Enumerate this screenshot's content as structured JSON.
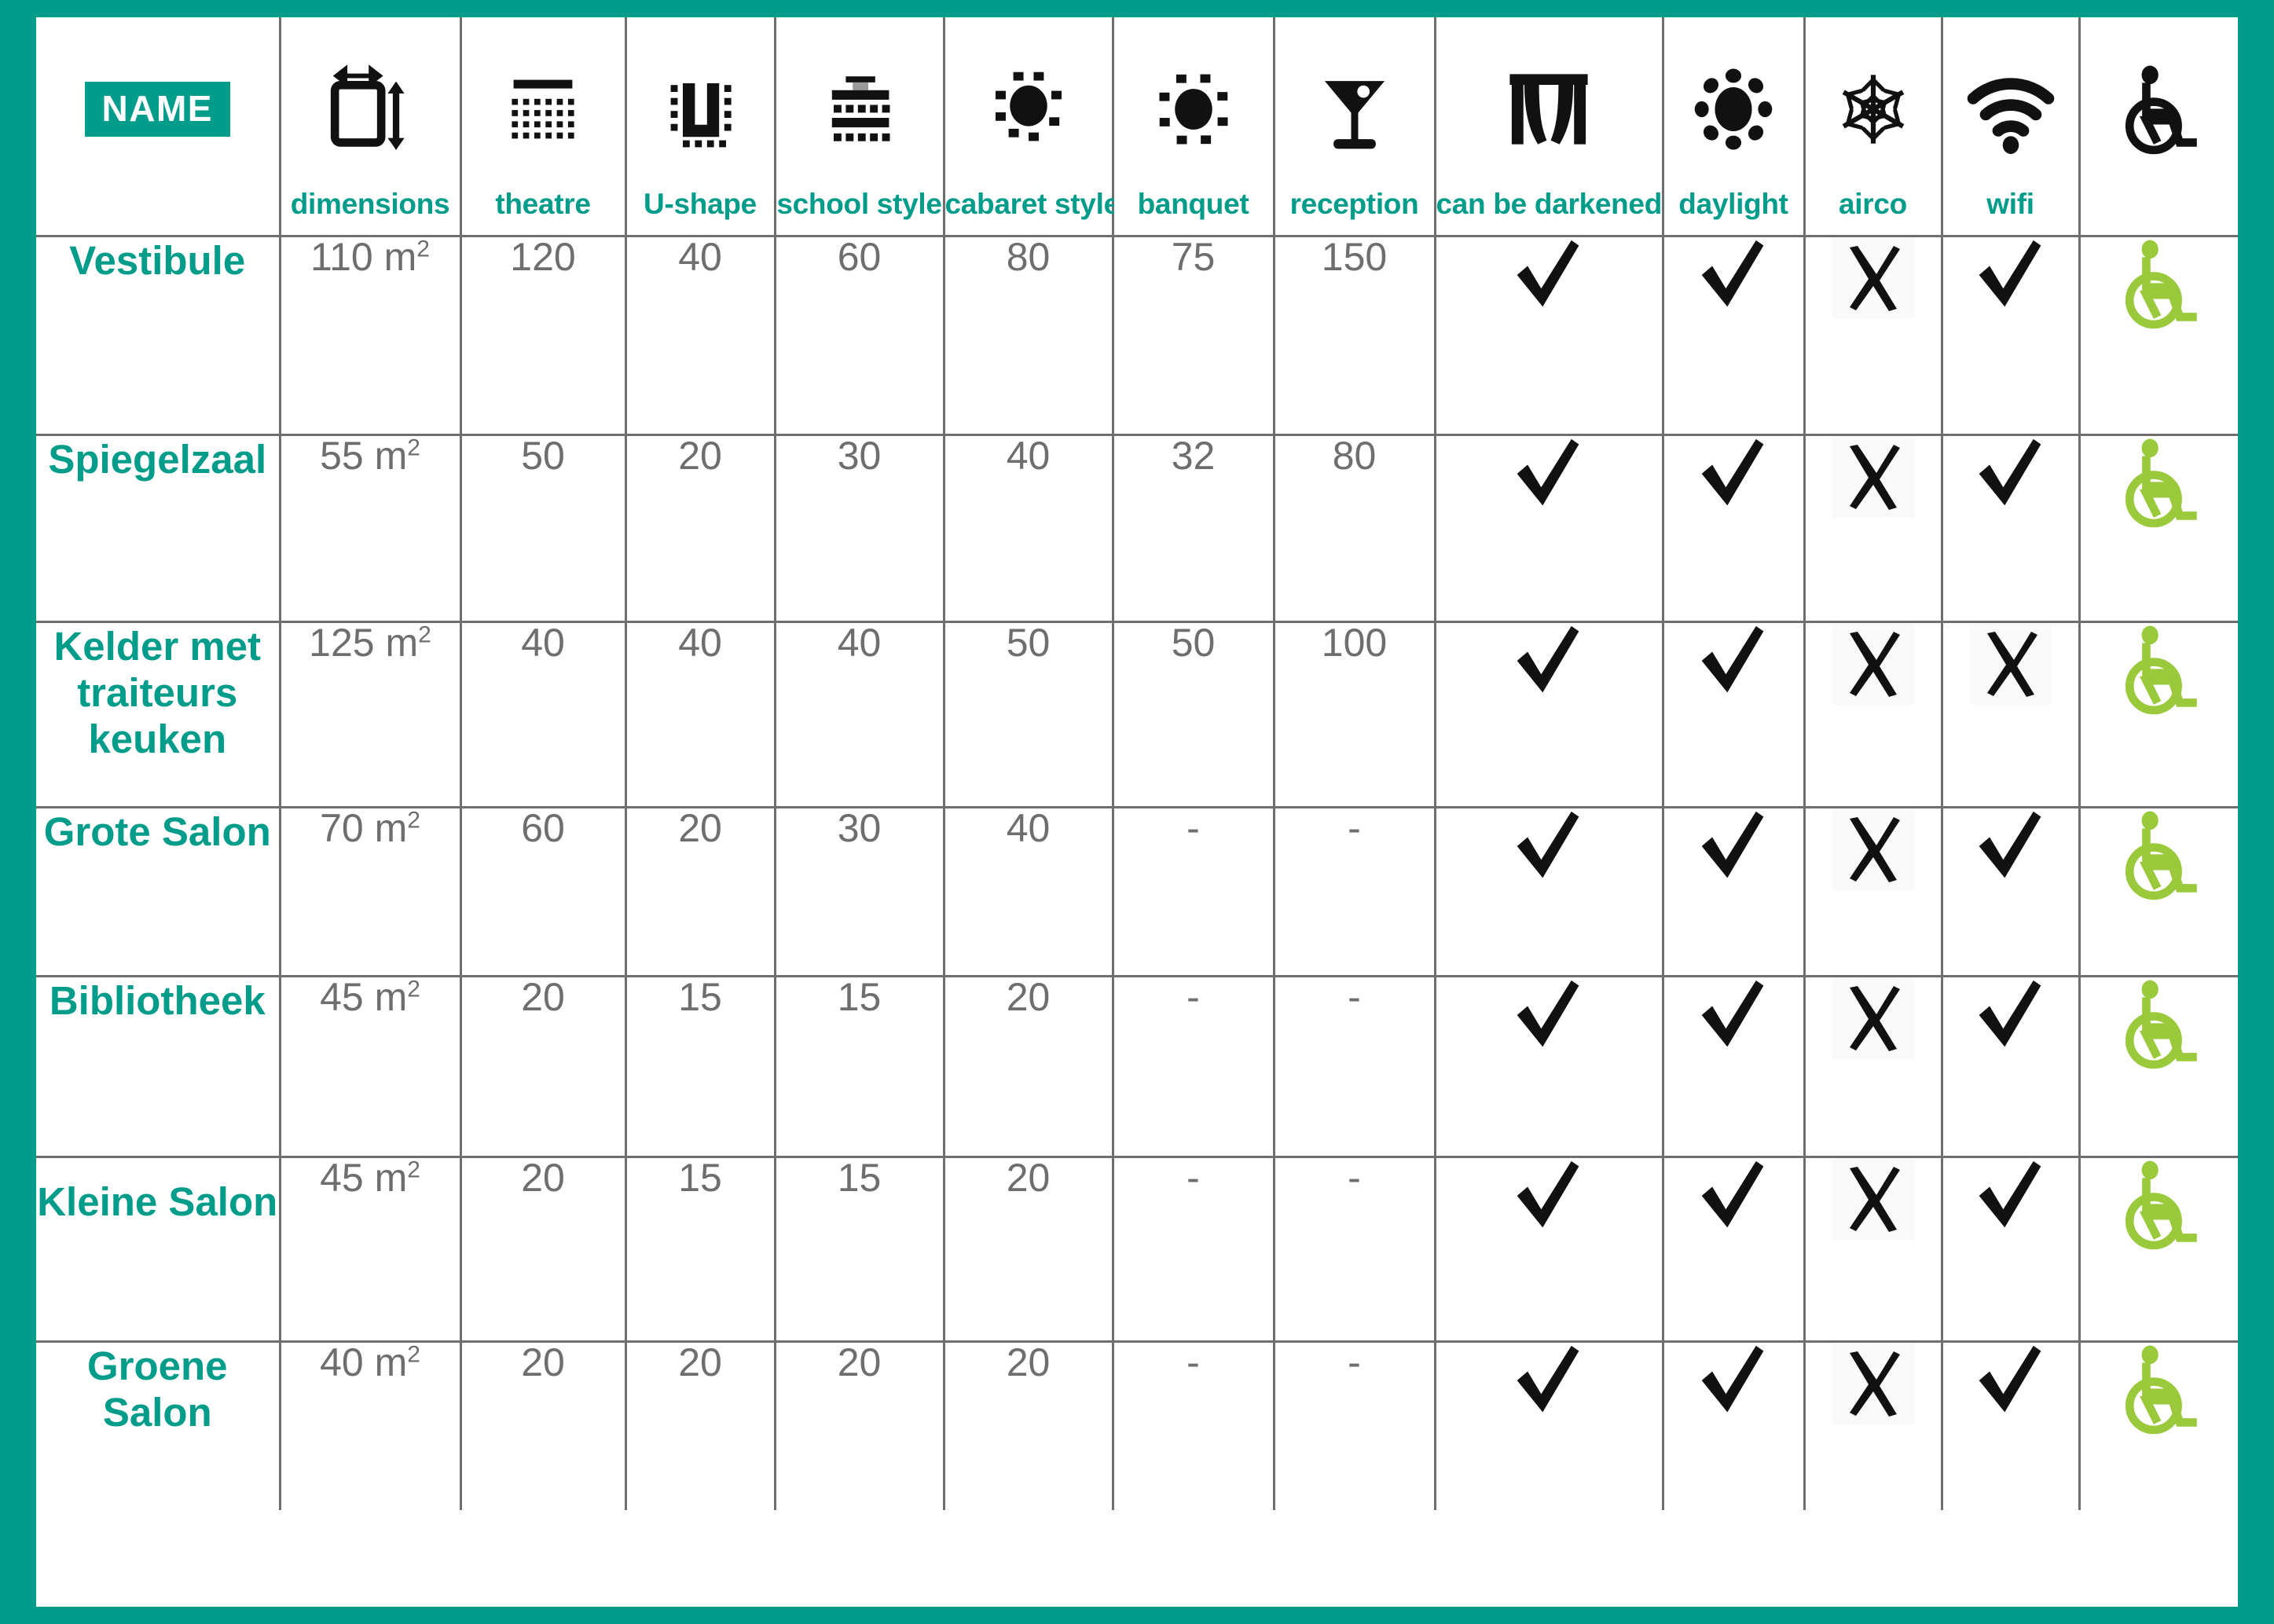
{
  "meta": {
    "accent_teal": "#019C8A",
    "grid_line": "#6e6e6e",
    "value_grey": "#6e6e6e",
    "wheelchair_green": "#9ACA3C",
    "mark_black": "#111111"
  },
  "header": {
    "name_badge": "NAME",
    "columns": [
      {
        "key": "name",
        "label": "",
        "icon": "name-badge"
      },
      {
        "key": "dimensions",
        "label": "dimensions",
        "icon": "dimensions-icon"
      },
      {
        "key": "theatre",
        "label": "theatre",
        "icon": "theatre-seating-icon"
      },
      {
        "key": "ushape",
        "label": "U-shape",
        "icon": "u-shape-seating-icon"
      },
      {
        "key": "school",
        "label": "school style",
        "icon": "school-style-seating-icon"
      },
      {
        "key": "cabaret",
        "label": "cabaret style",
        "icon": "cabaret-style-seating-icon"
      },
      {
        "key": "banquet",
        "label": "banquet",
        "icon": "banquet-seating-icon"
      },
      {
        "key": "reception",
        "label": "reception",
        "icon": "cocktail-glass-icon"
      },
      {
        "key": "darkened",
        "label": "can be darkened",
        "icon": "curtain-icon"
      },
      {
        "key": "daylight",
        "label": "daylight",
        "icon": "sun-icon"
      },
      {
        "key": "airco",
        "label": "airco",
        "icon": "snowflake-icon"
      },
      {
        "key": "wifi",
        "label": "wifi",
        "icon": "wifi-icon"
      },
      {
        "key": "accessible",
        "label": "",
        "icon": "wheelchair-icon"
      }
    ]
  },
  "rows": [
    {
      "name": "Vestibule",
      "name_align": "middle",
      "dimensions": "110 m",
      "dimensions_sup": "2",
      "theatre": "120",
      "ushape": "40",
      "school": "60",
      "cabaret": "80",
      "banquet": "75",
      "reception": "150",
      "darkened": "check",
      "daylight": "check",
      "airco": "cross",
      "wifi": "check",
      "accessible": "wheelchair"
    },
    {
      "name": "Spiegelzaal",
      "name_align": "middle",
      "dimensions": "55 m",
      "dimensions_sup": "2",
      "theatre": "50",
      "ushape": "20",
      "school": "30",
      "cabaret": "40",
      "banquet": "32",
      "reception": "80",
      "darkened": "check",
      "daylight": "check",
      "airco": "cross",
      "wifi": "check",
      "accessible": "wheelchair"
    },
    {
      "name": "Kelder met traiteurs keuken",
      "name_align": "middle",
      "dimensions": "125 m",
      "dimensions_sup": "2",
      "theatre": "40",
      "ushape": "40",
      "school": "40",
      "cabaret": "50",
      "banquet": "50",
      "reception": "100",
      "darkened": "check",
      "daylight": "check",
      "airco": "cross",
      "wifi": "cross",
      "accessible": "wheelchair"
    },
    {
      "name": "Grote Salon",
      "name_align": "middle",
      "dimensions": "70 m",
      "dimensions_sup": "2",
      "theatre": "60",
      "ushape": "20",
      "school": "30",
      "cabaret": "40",
      "banquet": "-",
      "reception": "-",
      "darkened": "check",
      "daylight": "check",
      "airco": "cross",
      "wifi": "check",
      "accessible": "wheelchair"
    },
    {
      "name": "Bibliotheek",
      "name_align": "middle",
      "dimensions": "45 m",
      "dimensions_sup": "2",
      "theatre": "20",
      "ushape": "15",
      "school": "15",
      "cabaret": "20",
      "banquet": "-",
      "reception": "-",
      "darkened": "check",
      "daylight": "check",
      "airco": "cross",
      "wifi": "check",
      "accessible": "wheelchair"
    },
    {
      "name": "Kleine Salon",
      "name_align": "top",
      "dimensions": "45 m",
      "dimensions_sup": "2",
      "theatre": "20",
      "ushape": "15",
      "school": "15",
      "cabaret": "20",
      "banquet": "-",
      "reception": "-",
      "darkened": "check",
      "daylight": "check",
      "airco": "cross",
      "wifi": "check",
      "accessible": "wheelchair"
    },
    {
      "name": "Groene Salon",
      "name_align": "middle",
      "dimensions": "40 m",
      "dimensions_sup": "2",
      "theatre": "20",
      "ushape": "20",
      "school": "20",
      "cabaret": "20",
      "banquet": "-",
      "reception": "-",
      "darkened": "check",
      "daylight": "check",
      "airco": "cross",
      "wifi": "check",
      "accessible": "wheelchair"
    }
  ]
}
